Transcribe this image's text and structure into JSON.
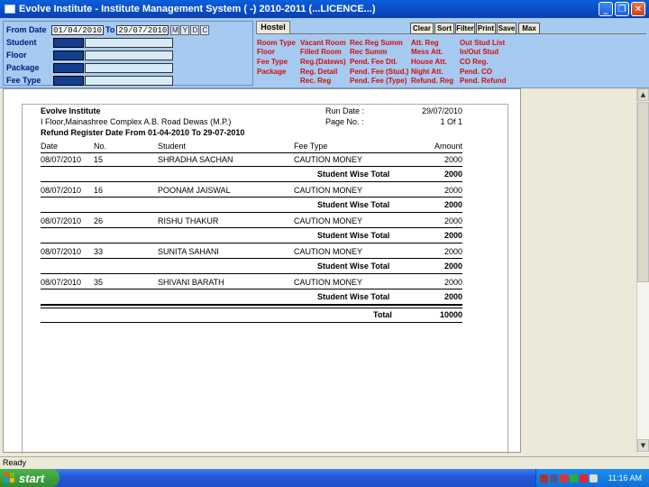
{
  "window": {
    "title": "Evolve Institute - Institute Management System ( -) 2010-2011 (...LICENCE...)"
  },
  "filters": {
    "from_label": "From Date",
    "from_value": "01/04/2010",
    "to_label": "To",
    "to_value": "29/07/2010",
    "ymd": [
      "M",
      "Y",
      "D",
      "C"
    ],
    "rows": [
      "Student",
      "Floor",
      "Package",
      "Fee Type"
    ]
  },
  "tab": {
    "label": "Hostel"
  },
  "toolbar": [
    "Clear",
    "Sort",
    "Filter",
    "Print",
    "Save",
    "Max"
  ],
  "menu": {
    "col1": [
      "Room Type",
      "Floor",
      "Fee Type",
      "Package"
    ],
    "col2": [
      "Vacant Room",
      "Filled Room",
      "Reg.(Datews)",
      "Reg. Detail",
      "Rec. Reg"
    ],
    "col3": [
      "Rec Reg Summ",
      "Rec Summ",
      "Pend. Fee Dtl.",
      "Pend. Fee (Stud.)",
      "Pend. Fee (Type)"
    ],
    "col4": [
      "Att. Reg",
      "Mess Att.",
      "House Att.",
      "Night Att.",
      "Refund. Reg"
    ],
    "col5": [
      "Out Stud List",
      "In/Out Stud",
      "CO Reg.",
      "Pend. CO",
      "Pend. Refund"
    ]
  },
  "report": {
    "institute": "Evolve Institute",
    "address": "I Floor,Mainashree Complex A.B. Road Dewas (M.P.)",
    "title": "Refund Register Date From 01-04-2010 To 29-07-2010",
    "run_date_label": "Run Date :",
    "run_date": "29/07/2010",
    "page_label": "Page No. :",
    "page_value": "1 Of 1",
    "columns": [
      "Date",
      "No.",
      "Student",
      "Fee Type",
      "Amount"
    ],
    "subtotal_label": "Student Wise Total",
    "rows": [
      {
        "date": "08/07/2010",
        "no": "15",
        "student": "SHRADHA SACHAN",
        "fee_type": "CAUTION MONEY",
        "amount": "2000",
        "subtotal": "2000"
      },
      {
        "date": "08/07/2010",
        "no": "16",
        "student": "POONAM JAISWAL",
        "fee_type": "CAUTION MONEY",
        "amount": "2000",
        "subtotal": "2000"
      },
      {
        "date": "08/07/2010",
        "no": "26",
        "student": "RISHU  THAKUR",
        "fee_type": "CAUTION MONEY",
        "amount": "2000",
        "subtotal": "2000"
      },
      {
        "date": "08/07/2010",
        "no": "33",
        "student": "SUNITA  SAHANI",
        "fee_type": "CAUTION MONEY",
        "amount": "2000",
        "subtotal": "2000"
      },
      {
        "date": "08/07/2010",
        "no": "35",
        "student": "SHIVANI  BARATH",
        "fee_type": "CAUTION MONEY",
        "amount": "2000",
        "subtotal": "2000"
      }
    ],
    "total_label": "Total",
    "total_value": "10000"
  },
  "status": {
    "text": "Ready"
  },
  "taskbar": {
    "start_label": "start",
    "clock": "11:16 AM"
  },
  "colors": {
    "menu_red": "#d01010",
    "panel_blue": "#a6caf0",
    "titlebar_blue": "#0b4cc4"
  }
}
